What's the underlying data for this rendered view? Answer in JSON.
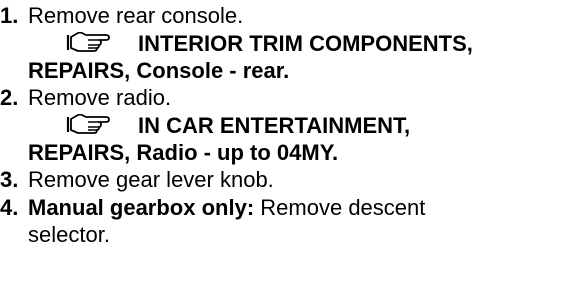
{
  "steps": [
    {
      "number": "1.",
      "text": "Remove rear console.",
      "ref_icon": "pointing-hand-icon",
      "ref_line1": "INTERIOR TRIM COMPONENTS,",
      "ref_line2": "REPAIRS, Console - rear."
    },
    {
      "number": "2.",
      "text": "Remove radio.",
      "ref_icon": "pointing-hand-icon",
      "ref_line1": "IN CAR ENTERTAINMENT,",
      "ref_line2": "REPAIRS, Radio - up to 04MY."
    },
    {
      "number": "3.",
      "text": "Remove gear lever knob."
    },
    {
      "number": "4.",
      "bold_prefix": "Manual gearbox only:",
      "text": "Remove descent",
      "text_cont": "selector."
    }
  ]
}
